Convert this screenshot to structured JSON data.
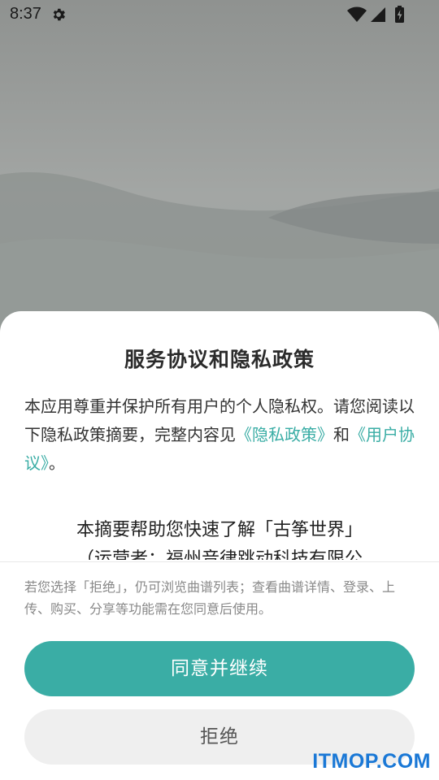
{
  "status_bar": {
    "time": "8:37"
  },
  "dialog": {
    "title": "服务协议和隐私政策",
    "intro_prefix": "本应用尊重并保护所有用户的个人隐私权。请您阅读以下隐私政策摘要，完整内容见",
    "privacy_link": "《隐私政策》",
    "and_text": "和",
    "terms_link": "《用户协议》",
    "intro_suffix": "。",
    "summary_line1": "本摘要帮助您快速了解「古筝世界」",
    "summary_line2": "（运营者：福州音律跳动科技有限公",
    "note": "若您选择「拒绝」，仍可浏览曲谱列表；查看曲谱详情、登录、上传、购买、分享等功能需在您同意后使用。",
    "agree_label": "同意并继续",
    "refuse_label": "拒绝"
  },
  "watermark": "ITMOP.COM",
  "colors": {
    "accent": "#3aada5",
    "watermark": "#1a78d6"
  },
  "icons": [
    "settings-gear-icon",
    "wifi-icon",
    "cell-signal-icon",
    "battery-charging-icon"
  ]
}
